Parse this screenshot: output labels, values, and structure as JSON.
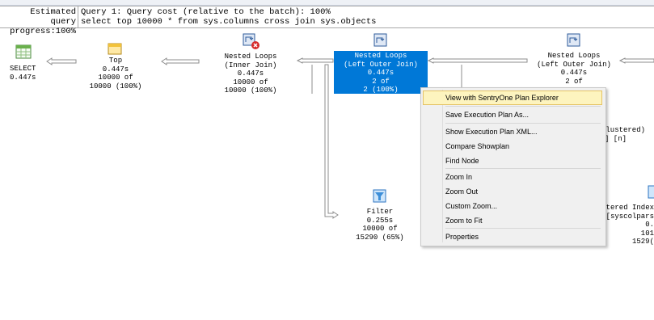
{
  "header": {
    "label_line1": "Estimated query",
    "label_line2": " progress:100%",
    "query_line1": "Query 1: Query cost (relative to the batch): 100%",
    "query_line2": "select top 10000 * from sys.columns cross join sys.objects"
  },
  "nodes": {
    "select": {
      "title": "SELECT",
      "time": "0.447s"
    },
    "top": {
      "title": "Top",
      "time": "0.447s",
      "rows": "10000 of",
      "est": "10000 (100%)"
    },
    "nested_inner": {
      "line1": "Nested Loops",
      "line2": "(Inner Join)",
      "time": "0.447s",
      "rows": "10000 of",
      "est": "10000 (100%)"
    },
    "nested_left_selected": {
      "line1": "Nested Loops",
      "line2": "(Left Outer Join)",
      "time": "0.447s",
      "rows": "2 of",
      "est": "2 (100%)"
    },
    "nested_left_right": {
      "line1": "Nested Loops",
      "line2": "(Left Outer Join)",
      "time": "0.447s",
      "rows": "2 of"
    },
    "filter": {
      "title": "Filter",
      "time": "0.255s",
      "rows": "10000 of",
      "est": "15290 (65%)"
    },
    "clustered_partial": {
      "line1": "Clustered)",
      "line2": "] [n]"
    },
    "index_partial": {
      "line1": "stered Index",
      "line2": "[syscolpars",
      "line3": "0.",
      "line4": "101",
      "line5": "1529("
    }
  },
  "context_menu": {
    "items": [
      "View with SentryOne Plan Explorer",
      "Save Execution Plan As...",
      "Show Execution Plan XML...",
      "Compare Showplan",
      "Find Node",
      "Zoom In",
      "Zoom Out",
      "Custom Zoom...",
      "Zoom to Fit",
      "Properties"
    ]
  }
}
